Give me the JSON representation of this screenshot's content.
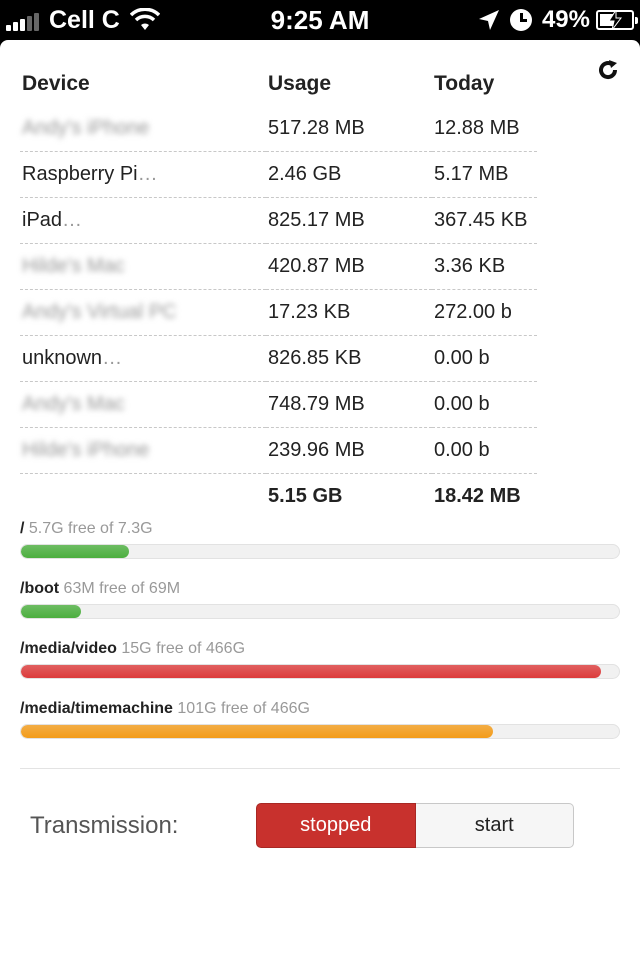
{
  "status_bar": {
    "carrier": "Cell C",
    "time": "9:25 AM",
    "battery": "49%",
    "battery_level": 0.49,
    "icons": [
      "signal-icon",
      "wifi-icon",
      "location-arrow-icon",
      "alarm-clock-icon",
      "battery-charging-icon"
    ]
  },
  "toolbar": {
    "refresh_icon": "refresh-icon"
  },
  "usage_table": {
    "headers": {
      "device": "Device",
      "usage": "Usage",
      "today": "Today"
    },
    "rows": [
      {
        "device": "Andy's iPhone",
        "usage": "517.28 MB",
        "today": "12.88 MB"
      },
      {
        "device": "Raspberry Pi",
        "usage": "2.46 GB",
        "today": "5.17 MB"
      },
      {
        "device": "iPad",
        "usage": "825.17 MB",
        "today": "367.45 KB"
      },
      {
        "device": "Hilde's Mac",
        "usage": "420.87 MB",
        "today": "3.36 KB"
      },
      {
        "device": "Andy's Virtual PC",
        "usage": "17.23 KB",
        "today": "272.00 b"
      },
      {
        "device": "unknown",
        "usage": "826.85 KB",
        "today": "0.00 b"
      },
      {
        "device": "Andy's Mac",
        "usage": "748.79 MB",
        "today": "0.00 b"
      },
      {
        "device": "Hilde's iPhone",
        "usage": "239.96 MB",
        "today": "0.00 b"
      }
    ],
    "ellipsis": "…",
    "total": {
      "usage": "5.15 GB",
      "today": "18.42 MB"
    }
  },
  "disks": [
    {
      "mount": "/",
      "info": "5.7G free of 7.3G",
      "used_fraction": 0.18,
      "color": "#4caf3f"
    },
    {
      "mount": "/boot",
      "info": "63M free of 69M",
      "used_fraction": 0.1,
      "color": "#4caf3f"
    },
    {
      "mount": "/media/video",
      "info": "15G free of 466G",
      "used_fraction": 0.97,
      "color": "#dc3b3b"
    },
    {
      "mount": "/media/timemachine",
      "info": "101G free of 466G",
      "used_fraction": 0.79,
      "color": "#f39c1a"
    }
  ],
  "transmission": {
    "label": "Transmission:",
    "stopped": "stopped",
    "start": "start",
    "state": "stopped",
    "active_color": "#c8312d"
  }
}
